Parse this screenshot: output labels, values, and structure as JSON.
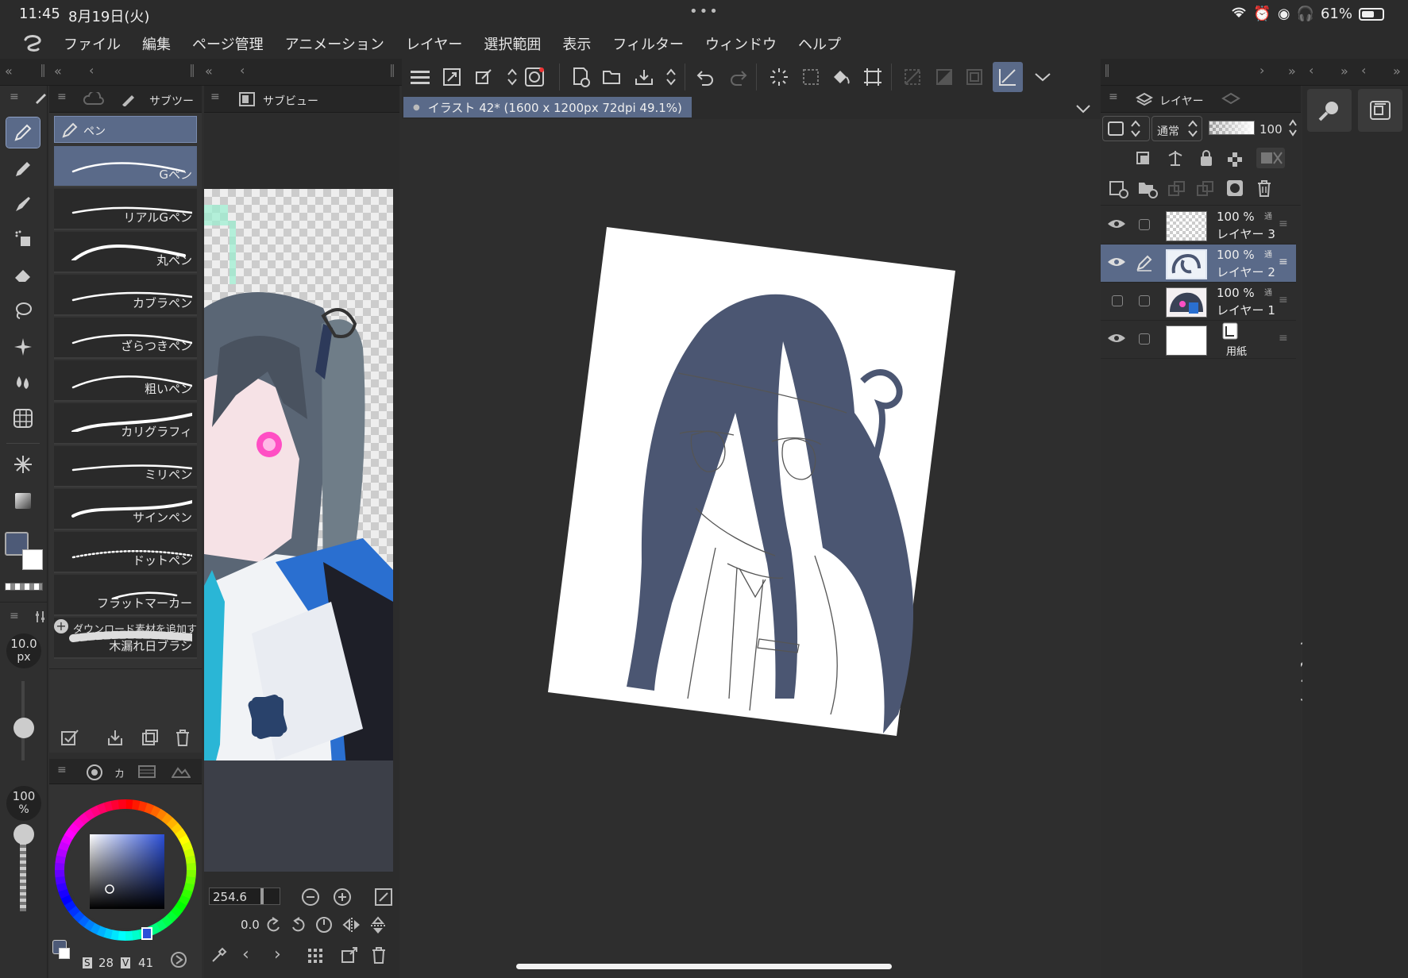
{
  "status": {
    "time": "11:45",
    "date": "8月19日(火)",
    "battery": "61%",
    "battery_level": 0.61
  },
  "menu": [
    "ファイル",
    "編集",
    "ページ管理",
    "アニメーション",
    "レイヤー",
    "選択範囲",
    "表示",
    "フィルター",
    "ウィンドウ",
    "ヘルプ"
  ],
  "tool_property_tab": "サブツー",
  "subview_tab": "サブビュー",
  "brush_category": "ペン",
  "brushes": [
    "Gペン",
    "リアルGペン",
    "丸ペン",
    "カブラペン",
    "ざらつきペン",
    "粗いペン",
    "カリグラフィ",
    "ミリペン",
    "サインペン",
    "ドットペン",
    "フラットマーカー",
    "木漏れ日ブラシ"
  ],
  "download_label": "ダウンロード素材を追加す",
  "brush_size": {
    "value": "10.0",
    "unit": "px"
  },
  "opacity": {
    "value": "100",
    "unit": "%"
  },
  "color_panel_tab": "カ",
  "color_values": {
    "s_label": "S",
    "s": "28",
    "v_label": "V",
    "v": "41"
  },
  "main_color": "#4d5a77",
  "sub_color": "#ffffff",
  "doc_tab": "イラスト 42* (1600 x 1200px 72dpi 49.1%)",
  "subview_zoom": "254.6",
  "subview_rotation": "0.0",
  "layer_panel": {
    "tab": "レイヤー",
    "blend_mode": "通常",
    "opacity": "100",
    "layers": [
      {
        "pct": "100 %",
        "name": "レイヤー 3",
        "visible": true,
        "selected": false
      },
      {
        "pct": "100 %",
        "name": "レイヤー 2",
        "visible": true,
        "selected": true
      },
      {
        "pct": "100 %",
        "name": "レイヤー 1",
        "visible": false,
        "selected": false
      },
      {
        "pct": "",
        "name": "用紙",
        "visible": true,
        "selected": false
      }
    ]
  }
}
